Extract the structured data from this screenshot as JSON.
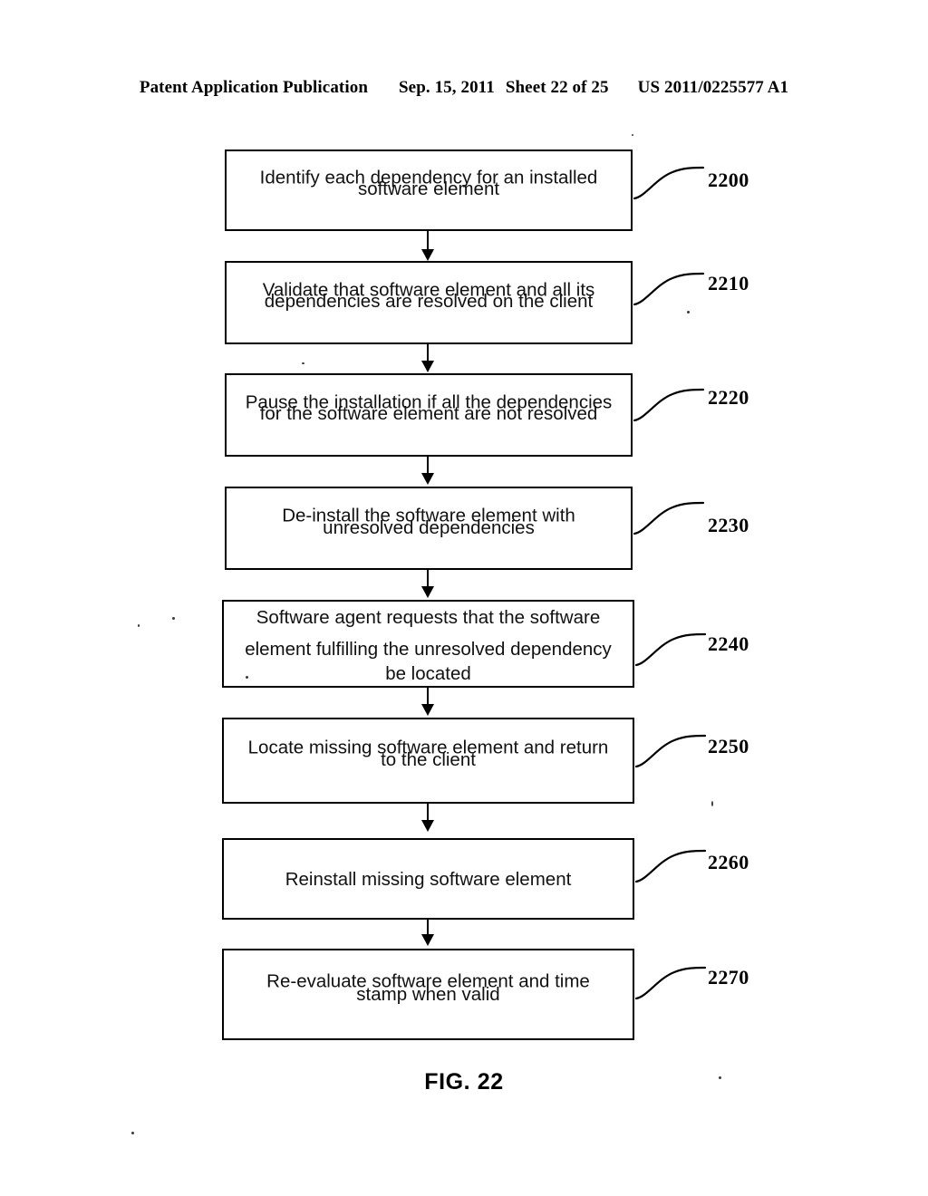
{
  "header": {
    "publication": "Patent Application Publication",
    "date": "Sep. 15, 2011",
    "sheet": "Sheet 22 of 25",
    "document_number": "US 2011/0225577 A1"
  },
  "figure": {
    "caption": "FIG. 22"
  },
  "flowchart": {
    "type": "flowchart",
    "orientation": "vertical",
    "connector": "downward-arrow",
    "steps": [
      {
        "ref": "2200",
        "text": "Identify each dependency for an installed software element",
        "lines": [
          "Identify each dependency for an installed",
          "software element"
        ]
      },
      {
        "ref": "2210",
        "text": "Validate that software element and all its dependencies are resolved on the client",
        "lines": [
          "Validate that software element and all its",
          "dependencies are resolved on the client"
        ]
      },
      {
        "ref": "2220",
        "text": "Pause the installation if all the dependencies for the software element are not resolved",
        "lines": [
          "Pause the installation if all the dependencies",
          "for the software element are not resolved"
        ]
      },
      {
        "ref": "2230",
        "text": "De-install the software element with unresolved dependencies",
        "lines": [
          "De-install the software element with",
          "unresolved dependencies"
        ]
      },
      {
        "ref": "2240",
        "text": "Software agent requests that the software element fulfilling the unresolved dependency be located",
        "lines": [
          "Software agent requests that the software",
          "element fulfilling the unresolved dependency",
          "be located"
        ]
      },
      {
        "ref": "2250",
        "text": "Locate missing software element and return to the client",
        "lines": [
          "Locate missing software element and return",
          "to the client"
        ]
      },
      {
        "ref": "2260",
        "text": "Reinstall missing software element",
        "lines": [
          "Reinstall missing software element"
        ]
      },
      {
        "ref": "2270",
        "text": "Re-evaluate software element and time stamp when valid",
        "lines": [
          "Re-evaluate software element and time",
          "stamp when valid"
        ]
      }
    ]
  }
}
